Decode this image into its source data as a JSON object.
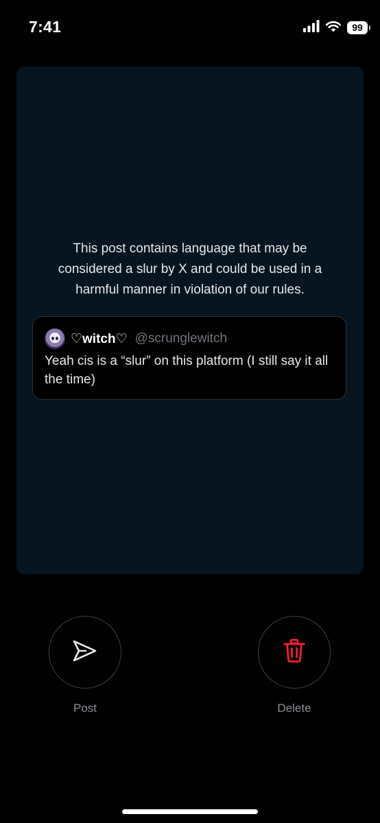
{
  "status_bar": {
    "time": "7:41",
    "battery": "99",
    "icons": [
      "cellular-signal-icon",
      "wifi-icon",
      "battery-icon"
    ]
  },
  "notice": {
    "text": "This post contains language that may be considered a slur by X and could be used in a harmful manner in violation of our rules."
  },
  "quoted_post": {
    "display_name": "♡witch♡",
    "handle": "@scrunglewitch",
    "body": "Yeah cis is a “slur” on this platform (I still say it all the time)"
  },
  "actions": {
    "post": {
      "label": "Post",
      "icon": "send-icon",
      "color": "#e7e9ea"
    },
    "delete": {
      "label": "Delete",
      "icon": "trash-icon",
      "color": "#f4212e"
    }
  },
  "colors": {
    "background": "#000000",
    "card": "#071520",
    "text": "#e7e9ea",
    "muted": "#71767b",
    "danger": "#f4212e"
  }
}
